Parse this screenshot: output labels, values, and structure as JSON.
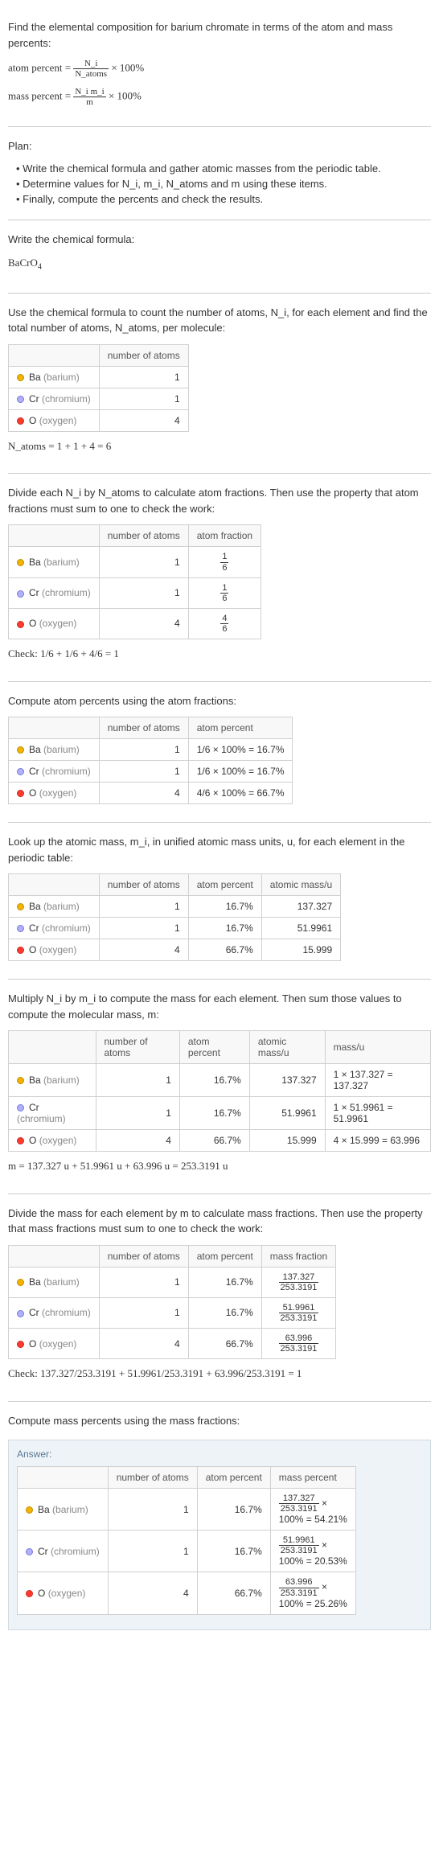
{
  "intro": {
    "line1": "Find the elemental composition for barium chromate in terms of the atom and mass percents:",
    "atom_label": "atom percent = ",
    "atom_frac_num": "N_i",
    "atom_frac_den": "N_atoms",
    "times100": " × 100%",
    "mass_label": "mass percent = ",
    "mass_frac_num": "N_i m_i",
    "mass_frac_den": "m"
  },
  "plan": {
    "title": "Plan:",
    "b1": "• Write the chemical formula and gather atomic masses from the periodic table.",
    "b2": "• Determine values for N_i, m_i, N_atoms and m using these items.",
    "b3": "• Finally, compute the percents and check the results."
  },
  "step_formula": {
    "title": "Write the chemical formula:",
    "formula": "BaCrO_4"
  },
  "step_count": {
    "title": "Use the chemical formula to count the number of atoms, N_i, for each element and find the total number of atoms, N_atoms, per molecule:",
    "hdr_num": "number of atoms",
    "sum": "N_atoms = 1 + 1 + 4 = 6"
  },
  "elements": {
    "ba": {
      "label": "Ba",
      "paren": "(barium)"
    },
    "cr": {
      "label": "Cr",
      "paren": "(chromium)"
    },
    "o": {
      "label": "O",
      "paren": "(oxygen)"
    },
    "n_ba": "1",
    "n_cr": "1",
    "n_o": "4"
  },
  "step_atomfrac": {
    "title": "Divide each N_i by N_atoms to calculate atom fractions. Then use the property that atom fractions must sum to one to check the work:",
    "hdr_frac": "atom fraction",
    "f_ba_num": "1",
    "f_ba_den": "6",
    "f_cr_num": "1",
    "f_cr_den": "6",
    "f_o_num": "4",
    "f_o_den": "6",
    "check": "Check: 1/6 + 1/6 + 4/6 = 1"
  },
  "step_atompct": {
    "title": "Compute atom percents using the atom fractions:",
    "hdr_pct": "atom percent",
    "ba": "1/6 × 100% = 16.7%",
    "cr": "1/6 × 100% = 16.7%",
    "o": "4/6 × 100% = 66.7%"
  },
  "step_atommass": {
    "title": "Look up the atomic mass, m_i, in unified atomic mass units, u, for each element in the periodic table:",
    "hdr_mass": "atomic mass/u",
    "ba_pct": "16.7%",
    "cr_pct": "16.7%",
    "o_pct": "66.7%",
    "ba_m": "137.327",
    "cr_m": "51.9961",
    "o_m": "15.999"
  },
  "step_mult": {
    "title": "Multiply N_i by m_i to compute the mass for each element. Then sum those values to compute the molecular mass, m:",
    "hdr_massu": "mass/u",
    "ba_calc": "1 × 137.327 = 137.327",
    "cr_calc": "1 × 51.9961 = 51.9961",
    "o_calc": "4 × 15.999 = 63.996",
    "sum": "m = 137.327 u + 51.9961 u + 63.996 u = 253.3191 u"
  },
  "step_massfrac": {
    "title": "Divide the mass for each element by m to calculate mass fractions. Then use the property that mass fractions must sum to one to check the work:",
    "hdr_mfrac": "mass fraction",
    "ba_num": "137.327",
    "ba_den": "253.3191",
    "cr_num": "51.9961",
    "cr_den": "253.3191",
    "o_num": "63.996",
    "o_den": "253.3191",
    "check": "Check: 137.327/253.3191 + 51.9961/253.3191 + 63.996/253.3191 = 1"
  },
  "step_masspct": {
    "title": "Compute mass percents using the mass fractions:"
  },
  "answer": {
    "title": "Answer:",
    "hdr_num": "number of atoms",
    "hdr_apct": "atom percent",
    "hdr_mpct": "mass percent",
    "ba_line1": "137.327",
    "ba_line2": "253.3191",
    "ba_line3": "100% = 54.21%",
    "cr_line1": "51.9961",
    "cr_line2": "253.3191",
    "cr_line3": "100% = 20.53%",
    "o_line1": "63.996",
    "o_line2": "253.3191",
    "o_line3": "100% = 25.26%",
    "times": " ×"
  },
  "chart_data": {
    "type": "table",
    "compound": "BaCrO_4",
    "molecular_mass_u": 253.3191,
    "n_atoms_total": 6,
    "elements": [
      {
        "symbol": "Ba",
        "name": "barium",
        "n": 1,
        "atom_fraction_num": 1,
        "atom_fraction_den": 6,
        "atom_percent": 16.7,
        "atomic_mass_u": 137.327,
        "mass_u": 137.327,
        "mass_fraction_num": 137.327,
        "mass_fraction_den": 253.3191,
        "mass_percent": 54.21
      },
      {
        "symbol": "Cr",
        "name": "chromium",
        "n": 1,
        "atom_fraction_num": 1,
        "atom_fraction_den": 6,
        "atom_percent": 16.7,
        "atomic_mass_u": 51.9961,
        "mass_u": 51.9961,
        "mass_fraction_num": 51.9961,
        "mass_fraction_den": 253.3191,
        "mass_percent": 20.53
      },
      {
        "symbol": "O",
        "name": "oxygen",
        "n": 4,
        "atom_fraction_num": 4,
        "atom_fraction_den": 6,
        "atom_percent": 66.7,
        "atomic_mass_u": 15.999,
        "mass_u": 63.996,
        "mass_fraction_num": 63.996,
        "mass_fraction_den": 253.3191,
        "mass_percent": 25.26
      }
    ]
  }
}
